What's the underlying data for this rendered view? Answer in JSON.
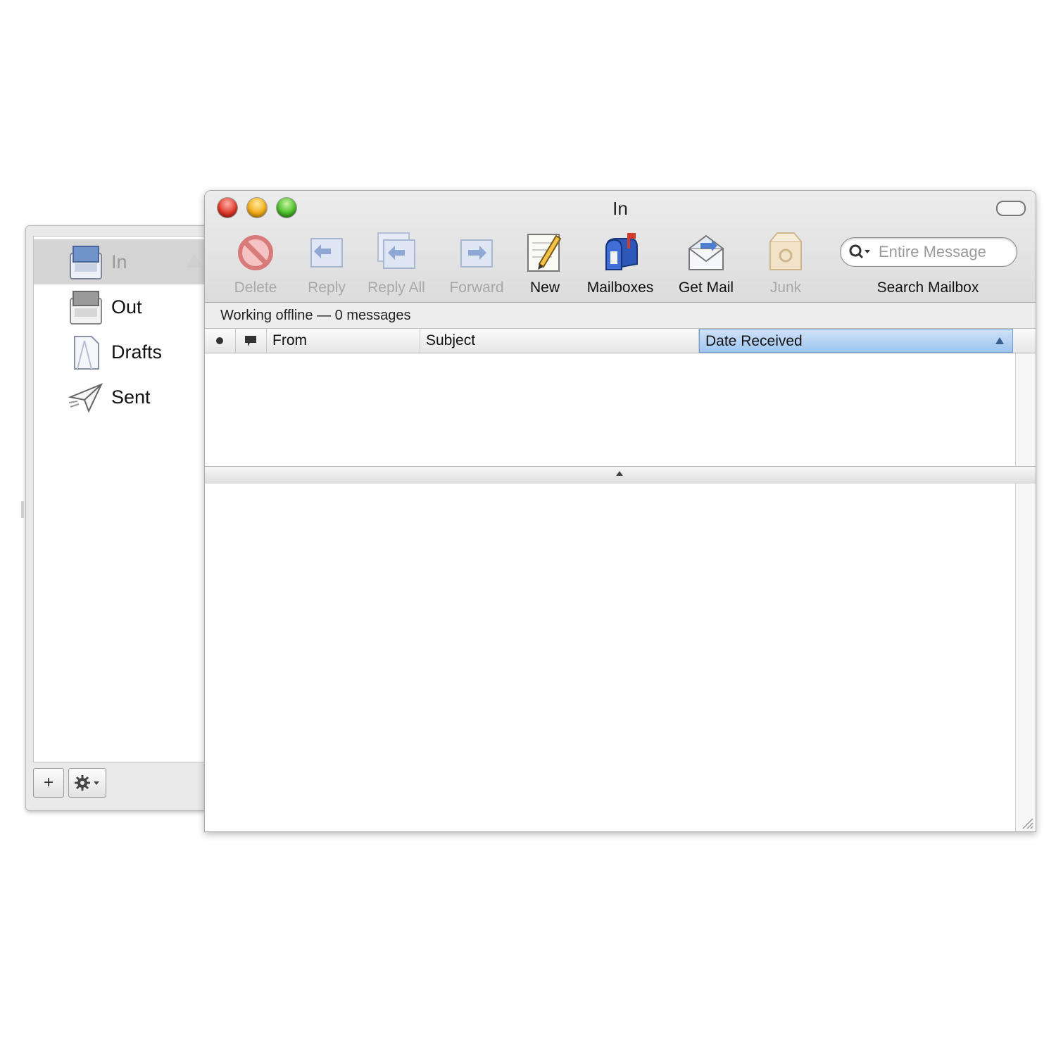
{
  "window": {
    "title": "In"
  },
  "toolbar": {
    "delete_label": "Delete",
    "reply_label": "Reply",
    "reply_all_label": "Reply All",
    "forward_label": "Forward",
    "new_label": "New",
    "mailboxes_label": "Mailboxes",
    "get_mail_label": "Get Mail",
    "junk_label": "Junk",
    "search_placeholder": "Entire Message",
    "search_label": "Search Mailbox"
  },
  "status": {
    "text": "Working offline — 0 messages"
  },
  "columns": {
    "from": "From",
    "subject": "Subject",
    "date": "Date Received"
  },
  "mailboxes": [
    {
      "label": "In"
    },
    {
      "label": "Out"
    },
    {
      "label": "Drafts"
    },
    {
      "label": "Sent"
    }
  ],
  "drawer": {
    "add_label": "+"
  },
  "colors": {
    "sort_highlight": "#9ec5ef",
    "window_chrome": "#dcdcdc"
  }
}
